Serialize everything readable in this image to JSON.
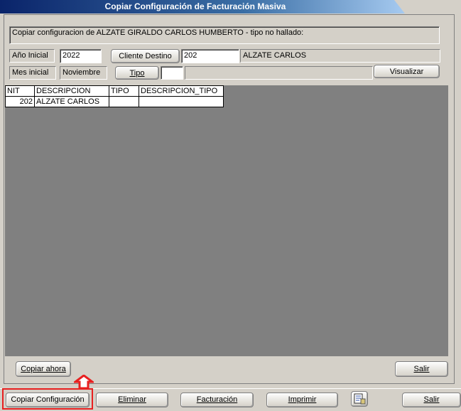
{
  "window": {
    "title": "Copiar Configuración de Facturación Masiva"
  },
  "message": "Copiar configuracion de ALZATE GIRALDO CARLOS HUMBERTO - tipo no hallado:",
  "form": {
    "ano_label": "Año  Inicial",
    "ano_value": "2022",
    "mes_label": "Mes inicial",
    "mes_value": "Noviembre",
    "cliente_button": "Cliente Destino",
    "cliente_code": "202",
    "cliente_name": "ALZATE  CARLOS",
    "tipo_button": "Tipo",
    "tipo_code": "",
    "tipo_desc": "",
    "visualizar_button": "Visualizar"
  },
  "grid": {
    "columns": [
      "NIT",
      "DESCRIPCION",
      "TIPO",
      "DESCRIPCION_TIPO"
    ],
    "rows": [
      {
        "nit": "202",
        "descripcion": "ALZATE  CARLOS",
        "tipo": "",
        "descripcion_tipo": ""
      }
    ]
  },
  "panel_buttons": {
    "copiar_ahora": "Copiar ahora",
    "salir": "Salir"
  },
  "toolbar": {
    "copiar_configuracion": "Copiar Configuración",
    "eliminar": "Eliminar",
    "facturacion": "Facturación",
    "imprimir": "Imprimir",
    "salir": "Salir"
  },
  "colors": {
    "title_start": "#0a246a",
    "title_end": "#a6caf0",
    "highlight": "#e82020",
    "grid_bg": "#808080"
  }
}
